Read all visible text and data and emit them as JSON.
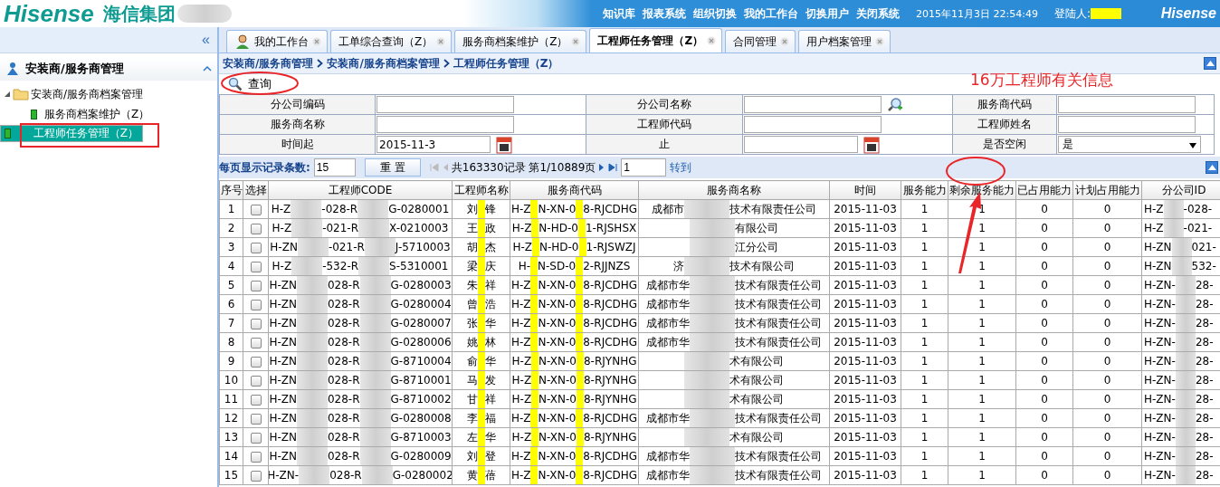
{
  "header": {
    "logo": "Hisense",
    "group_name": "海信集团",
    "menu": [
      "知识库",
      "报表系统",
      "组织切换",
      "我的工作台",
      "切换用户",
      "关闭系统"
    ],
    "datetime": "2015年11月3日 22:54:49",
    "login_label": "登陆人:",
    "brand": "Hisense"
  },
  "sidebar": {
    "collapse": "«",
    "section": "安装商/服务商管理",
    "expanded": true,
    "tree": [
      {
        "label": "安装商/服务商档案管理",
        "expanded": true,
        "children": [
          {
            "label": "服务商档案维护（Z）",
            "selected": false
          },
          {
            "label": "工程师任务管理（Z）",
            "selected": true
          }
        ]
      }
    ]
  },
  "tabs": [
    {
      "label": "我的工作台",
      "selected": false,
      "kind": "home"
    },
    {
      "label": "工单综合查询（Z）",
      "selected": false,
      "kind": "page"
    },
    {
      "label": "服务商档案维护（Z）",
      "selected": false,
      "kind": "page"
    },
    {
      "label": "工程师任务管理（Z）",
      "selected": true,
      "kind": "page"
    },
    {
      "label": "合同管理",
      "selected": false,
      "kind": "page"
    },
    {
      "label": "用户档案管理",
      "selected": false,
      "kind": "page"
    }
  ],
  "breadcrumb": [
    "安装商/服务商管理",
    "安装商/服务商档案管理",
    "工程师任务管理（Z）"
  ],
  "query_button": "查询",
  "annotation_note": "16万工程师有关信息",
  "form": [
    [
      {
        "label": "分公司编码",
        "kind": "text"
      },
      {
        "label": "分公司名称",
        "kind": "lookup"
      },
      {
        "label": "服务商代码",
        "kind": "text"
      }
    ],
    [
      {
        "label": "服务商名称",
        "kind": "text"
      },
      {
        "label": "工程师代码",
        "kind": "text"
      },
      {
        "label": "工程师姓名",
        "kind": "text"
      }
    ],
    [
      {
        "label": "时间起",
        "kind": "date",
        "value": "2015-11-3"
      },
      {
        "label": "止",
        "kind": "date"
      },
      {
        "label": "是否空闲",
        "kind": "select",
        "value": "是"
      }
    ]
  ],
  "pager": {
    "page_size_label": "每页显示记录条数:",
    "page_size": "15",
    "reset": "重 置",
    "summary": "共163330记录 第1/10889页",
    "page": "1",
    "goto": "转到"
  },
  "table": {
    "columns": [
      "序号",
      "选择",
      "工程师CODE",
      "工程师名称",
      "服务商代码",
      "服务商名称",
      "时间",
      "服务能力",
      "剩余服务能力",
      "已占用能力",
      "计划占用能力",
      "分公司ID"
    ],
    "rows": [
      {
        "no": "1",
        "checked": false,
        "code": [
          "H-Z",
          "-028-R",
          "G-0280001"
        ],
        "engineer": [
          "刘",
          "锋"
        ],
        "provider_code": [
          "H-Z",
          "N-XN-0",
          "8-RJCDHG"
        ],
        "provider_name": [
          "成都市",
          "技术有限责任公司"
        ],
        "time": "2015-11-03",
        "capacity": "1",
        "remaining": "1",
        "used": "0",
        "planned": "0",
        "branch_id": [
          "H-Z",
          "-028-"
        ]
      },
      {
        "no": "2",
        "checked": false,
        "code": [
          "H-Z",
          "-021-R",
          "X-0210003"
        ],
        "engineer": [
          "王",
          "政"
        ],
        "provider_code": [
          "H-Z",
          "N-HD-0",
          "1-RJSHSX"
        ],
        "provider_name": [
          "有限公司"
        ],
        "time": "2015-11-03",
        "capacity": "1",
        "remaining": "1",
        "used": "0",
        "planned": "0",
        "branch_id": [
          "H-Z",
          "-021-"
        ]
      },
      {
        "no": "3",
        "checked": false,
        "code": [
          "H-ZN",
          "-021-R",
          "J-5710003"
        ],
        "engineer": [
          "胡",
          "杰"
        ],
        "provider_code": [
          "H-Z",
          "N-HD-0",
          "1-RJSWZJ"
        ],
        "provider_name": [
          "江分公司"
        ],
        "time": "2015-11-03",
        "capacity": "1",
        "remaining": "1",
        "used": "0",
        "planned": "0",
        "branch_id": [
          "H-ZN",
          "021-"
        ]
      },
      {
        "no": "4",
        "checked": false,
        "code": [
          "H-Z",
          "-532-R",
          "S-5310001"
        ],
        "engineer": [
          "梁",
          "庆"
        ],
        "provider_code": [
          "H-",
          "N-SD-0",
          "2-RJJNZS"
        ],
        "provider_name": [
          "济",
          "技术有限公司"
        ],
        "time": "2015-11-03",
        "capacity": "1",
        "remaining": "1",
        "used": "0",
        "planned": "0",
        "branch_id": [
          "H-ZN",
          "532-"
        ]
      },
      {
        "no": "5",
        "checked": false,
        "code": [
          "H-ZN",
          "028-R",
          "G-0280003"
        ],
        "engineer": [
          "朱",
          "祥"
        ],
        "provider_code": [
          "H-Z",
          "N-XN-0",
          "8-RJCDHG"
        ],
        "provider_name": [
          "成都市华",
          "技术有限责任公司"
        ],
        "time": "2015-11-03",
        "capacity": "1",
        "remaining": "1",
        "used": "0",
        "planned": "0",
        "branch_id": [
          "H-ZN-",
          "28-"
        ]
      },
      {
        "no": "6",
        "checked": false,
        "code": [
          "H-ZN",
          "028-R",
          "G-0280004"
        ],
        "engineer": [
          "曾",
          "浩"
        ],
        "provider_code": [
          "H-Z",
          "N-XN-0",
          "8-RJCDHG"
        ],
        "provider_name": [
          "成都市华",
          "技术有限责任公司"
        ],
        "time": "2015-11-03",
        "capacity": "1",
        "remaining": "1",
        "used": "0",
        "planned": "0",
        "branch_id": [
          "H-ZN-",
          "28-"
        ]
      },
      {
        "no": "7",
        "checked": false,
        "code": [
          "H-ZN",
          "028-R",
          "G-0280007"
        ],
        "engineer": [
          "张",
          "华"
        ],
        "provider_code": [
          "H-Z",
          "N-XN-0",
          "8-RJCDHG"
        ],
        "provider_name": [
          "成都市华",
          "技术有限责任公司"
        ],
        "time": "2015-11-03",
        "capacity": "1",
        "remaining": "1",
        "used": "0",
        "planned": "0",
        "branch_id": [
          "H-ZN-",
          "28-"
        ]
      },
      {
        "no": "8",
        "checked": false,
        "code": [
          "H-ZN",
          "028-R",
          "G-0280006"
        ],
        "engineer": [
          "姚",
          "林"
        ],
        "provider_code": [
          "H-Z",
          "N-XN-0",
          "8-RJCDHG"
        ],
        "provider_name": [
          "成都市华",
          "技术有限责任公司"
        ],
        "time": "2015-11-03",
        "capacity": "1",
        "remaining": "1",
        "used": "0",
        "planned": "0",
        "branch_id": [
          "H-ZN-",
          "28-"
        ]
      },
      {
        "no": "9",
        "checked": false,
        "code": [
          "H-ZN",
          "028-R",
          "G-8710004"
        ],
        "engineer": [
          "俞",
          "华"
        ],
        "provider_code": [
          "H-Z",
          "N-XN-0",
          "8-RJYNHG"
        ],
        "provider_name": [
          "术有限公司"
        ],
        "time": "2015-11-03",
        "capacity": "1",
        "remaining": "1",
        "used": "0",
        "planned": "0",
        "branch_id": [
          "H-ZN-",
          "28-"
        ]
      },
      {
        "no": "10",
        "checked": false,
        "code": [
          "H-ZN",
          "028-R",
          "G-8710001"
        ],
        "engineer": [
          "马",
          "发"
        ],
        "provider_code": [
          "H-Z",
          "N-XN-0",
          "8-RJYNHG"
        ],
        "provider_name": [
          "术有限公司"
        ],
        "time": "2015-11-03",
        "capacity": "1",
        "remaining": "1",
        "used": "0",
        "planned": "0",
        "branch_id": [
          "H-ZN-",
          "28-"
        ]
      },
      {
        "no": "11",
        "checked": false,
        "code": [
          "H-ZN",
          "028-R",
          "G-8710002"
        ],
        "engineer": [
          "甘",
          "祥"
        ],
        "provider_code": [
          "H-Z",
          "N-XN-0",
          "8-RJYNHG"
        ],
        "provider_name": [
          "术有限公司"
        ],
        "time": "2015-11-03",
        "capacity": "1",
        "remaining": "1",
        "used": "0",
        "planned": "0",
        "branch_id": [
          "H-ZN-",
          "28-"
        ]
      },
      {
        "no": "12",
        "checked": false,
        "code": [
          "H-ZN",
          "028-R",
          "G-0280008"
        ],
        "engineer": [
          "李",
          "福"
        ],
        "provider_code": [
          "H-Z",
          "N-XN-0",
          "8-RJCDHG"
        ],
        "provider_name": [
          "成都市华",
          "技术有限责任公司"
        ],
        "time": "2015-11-03",
        "capacity": "1",
        "remaining": "1",
        "used": "0",
        "planned": "0",
        "branch_id": [
          "H-ZN-",
          "28-"
        ]
      },
      {
        "no": "13",
        "checked": false,
        "code": [
          "H-ZN",
          "028-R",
          "G-8710003"
        ],
        "engineer": [
          "左",
          "华"
        ],
        "provider_code": [
          "H-Z",
          "N-XN-0",
          "8-RJYNHG"
        ],
        "provider_name": [
          "术有限公司"
        ],
        "time": "2015-11-03",
        "capacity": "1",
        "remaining": "1",
        "used": "0",
        "planned": "0",
        "branch_id": [
          "H-ZN-",
          "28-"
        ]
      },
      {
        "no": "14",
        "checked": false,
        "code": [
          "H-ZN",
          "028-R",
          "G-0280009"
        ],
        "engineer": [
          "刘",
          "登"
        ],
        "provider_code": [
          "H-Z",
          "N-XN-0",
          "8-RJCDHG"
        ],
        "provider_name": [
          "成都市华",
          "技术有限责任公司"
        ],
        "time": "2015-11-03",
        "capacity": "1",
        "remaining": "1",
        "used": "0",
        "planned": "0",
        "branch_id": [
          "H-ZN-",
          "28-"
        ]
      },
      {
        "no": "15",
        "checked": false,
        "code": [
          "H-ZN-",
          "028-R",
          "G-0280002"
        ],
        "engineer": [
          "黄",
          "蓓"
        ],
        "provider_code": [
          "H-Z",
          "N-XN-0",
          "8-RJCDHG"
        ],
        "provider_name": [
          "成都市华",
          "技术有限责任公司"
        ],
        "time": "2015-11-03",
        "capacity": "1",
        "remaining": "1",
        "used": "0",
        "planned": "0",
        "branch_id": [
          "H-ZN-",
          "28-"
        ]
      }
    ]
  }
}
